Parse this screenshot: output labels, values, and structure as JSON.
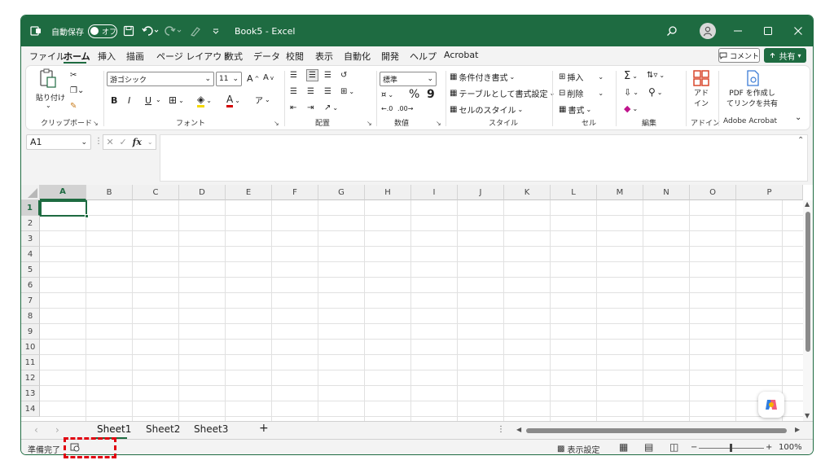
{
  "titlebar": {
    "autosave_label": "自動保存",
    "autosave_state": "オフ",
    "document_title": "Book5 - Excel"
  },
  "menu": {
    "tabs": [
      "ファイル",
      "ホーム",
      "挿入",
      "描画",
      "ページ レイアウト",
      "数式",
      "データ",
      "校閲",
      "表示",
      "自動化",
      "開発",
      "ヘルプ",
      "Acrobat"
    ],
    "active": "ホーム",
    "comment_label": "コメント",
    "share_label": "共有"
  },
  "ribbon": {
    "clipboard": {
      "paste_label": "貼り付け",
      "group_label": "クリップボード"
    },
    "font": {
      "font_name": "游ゴシック",
      "font_size": "11",
      "bold": "B",
      "italic": "I",
      "underline": "U",
      "group_label": "フォント"
    },
    "alignment": {
      "group_label": "配置"
    },
    "number": {
      "format": "標準",
      "percent": "%",
      "comma": "9",
      "group_label": "数値"
    },
    "styles": {
      "conditional": "条件付き書式",
      "table": "テーブルとして書式設定",
      "cell_styles": "セルのスタイル",
      "group_label": "スタイル"
    },
    "cells": {
      "insert": "挿入",
      "delete": "削除",
      "format": "書式",
      "group_label": "セル"
    },
    "editing": {
      "group_label": "編集"
    },
    "addins": {
      "label_line1": "アド",
      "label_line2": "イン",
      "group_label": "アドイン"
    },
    "acrobat": {
      "label_line1": "PDF を作成し",
      "label_line2": "てリンクを共有",
      "group_label": "Adobe Acrobat"
    }
  },
  "formula_bar": {
    "name_box": "A1",
    "fx": "fx",
    "content": ""
  },
  "grid": {
    "columns": [
      "A",
      "B",
      "C",
      "D",
      "E",
      "F",
      "G",
      "H",
      "I",
      "J",
      "K",
      "L",
      "M",
      "N",
      "O",
      "P"
    ],
    "rows": [
      "1",
      "2",
      "3",
      "4",
      "5",
      "6",
      "7",
      "8",
      "9",
      "10",
      "11",
      "12",
      "13",
      "14"
    ],
    "selected_cell": "A1"
  },
  "sheets": {
    "tabs": [
      "Sheet1",
      "Sheet2",
      "Sheet3"
    ],
    "active": "Sheet1",
    "add_label": "+"
  },
  "status": {
    "ready": "準備完了",
    "display_settings": "表示設定",
    "zoom": "100%",
    "zoom_minus": "−",
    "zoom_plus": "+"
  },
  "colors": {
    "accent": "#1e6b41",
    "highlight": "#e0000f"
  }
}
